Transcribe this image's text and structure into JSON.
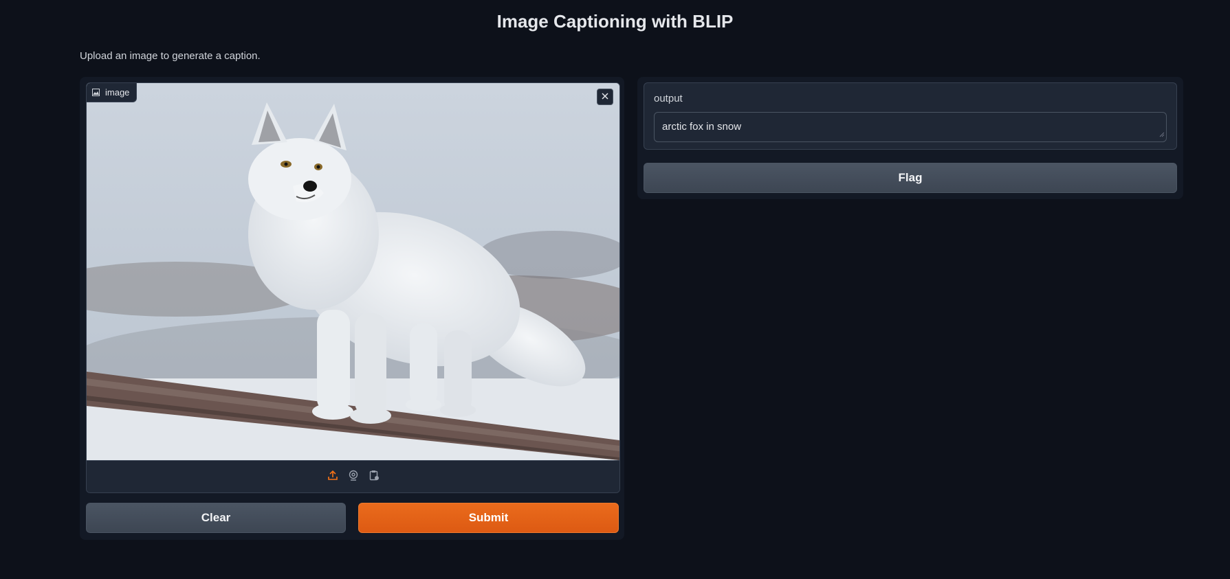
{
  "page": {
    "title": "Image Captioning with BLIP",
    "description": "Upload an image to generate a caption."
  },
  "input": {
    "label": "image",
    "label_icon": "image-icon",
    "close_icon": "close-icon",
    "image_subject": "arctic fox standing on a log in snow",
    "sources": [
      "upload-icon",
      "webcam-icon",
      "clipboard-icon"
    ],
    "active_source_color": "#f97316"
  },
  "buttons": {
    "clear": "Clear",
    "submit": "Submit",
    "flag": "Flag"
  },
  "output": {
    "label": "output",
    "value": "arctic fox in snow"
  },
  "colors": {
    "background": "#0d111a",
    "panel": "#131925",
    "accent": "#ea6b1c"
  }
}
